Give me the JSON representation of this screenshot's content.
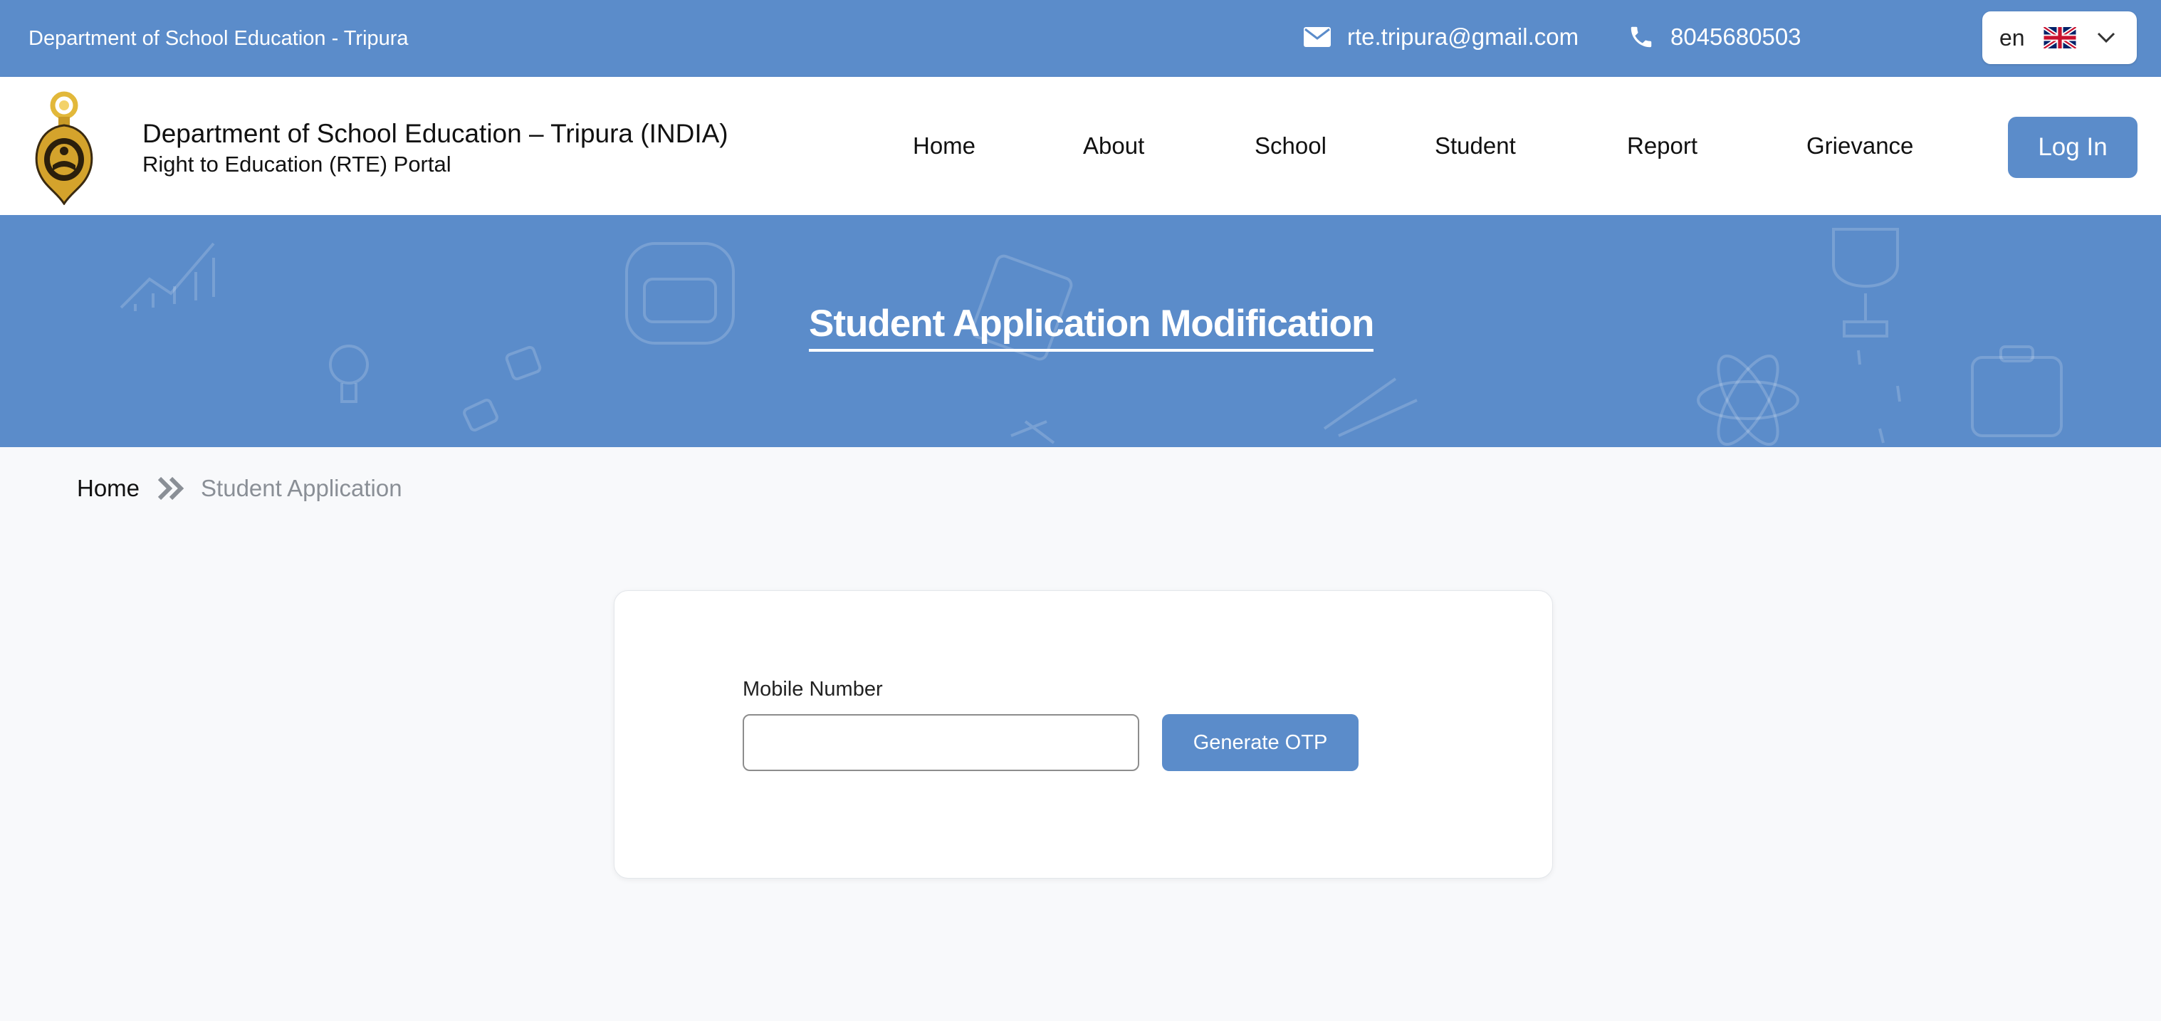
{
  "topbar": {
    "department": "Department of School Education - Tripura",
    "email": "rte.tripura@gmail.com",
    "phone": "8045680503",
    "language": "en"
  },
  "header": {
    "title": "Department of School Education – Tripura (INDIA)",
    "subtitle": "Right to Education (RTE) Portal",
    "nav": [
      "Home",
      "About",
      "School",
      "Student",
      "Report",
      "Grievance"
    ],
    "login_label": "Log In"
  },
  "banner": {
    "title": "Student Application Modification"
  },
  "breadcrumb": {
    "home": "Home",
    "current": "Student Application"
  },
  "form": {
    "mobile_label": "Mobile Number",
    "mobile_value": "",
    "generate_otp_label": "Generate OTP"
  },
  "colors": {
    "primary": "#5b8cca",
    "page_background": "#f8f9fb",
    "breadcrumb_muted": "#8a8f96"
  }
}
